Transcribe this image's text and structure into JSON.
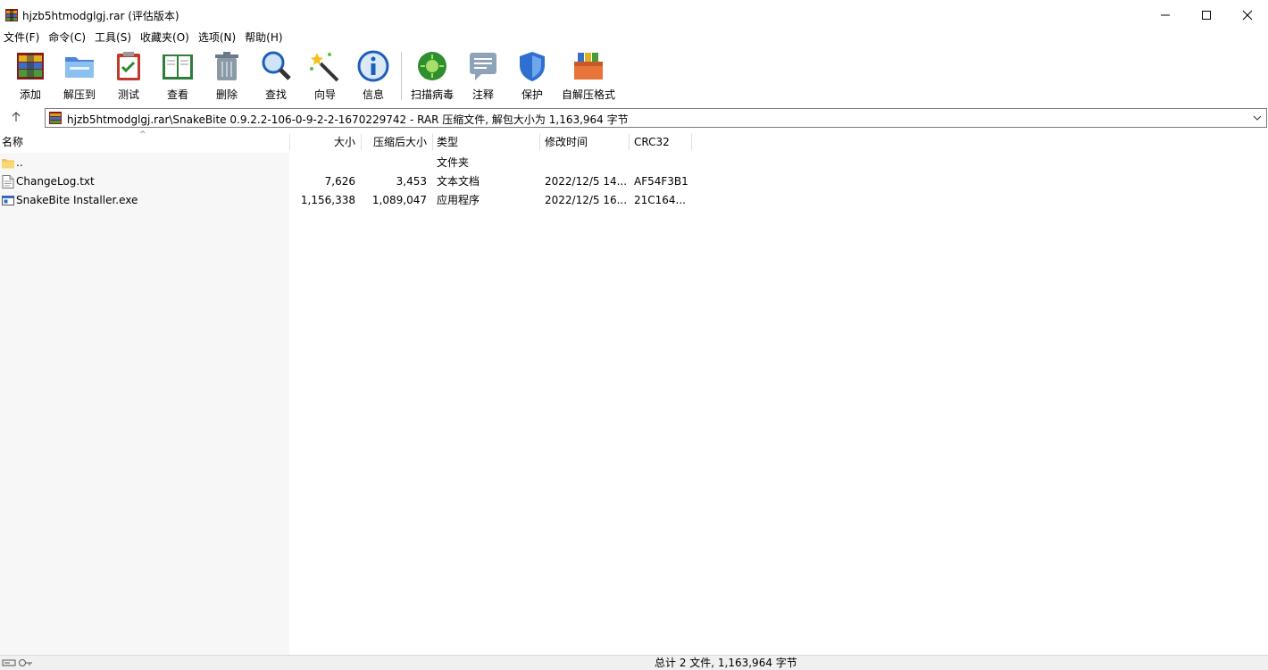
{
  "window": {
    "title": "hjzb5htmodglgj.rar (评估版本)"
  },
  "menu": [
    "文件(F)",
    "命令(C)",
    "工具(S)",
    "收藏夹(O)",
    "选项(N)",
    "帮助(H)"
  ],
  "toolbar": {
    "buttons": [
      {
        "label": "添加",
        "icon": "add-archive-icon"
      },
      {
        "label": "解压到",
        "icon": "extract-to-folder-icon"
      },
      {
        "label": "测试",
        "icon": "test-clipboard-icon"
      },
      {
        "label": "查看",
        "icon": "view-book-icon"
      },
      {
        "label": "删除",
        "icon": "trash-icon"
      },
      {
        "label": "查找",
        "icon": "magnifier-icon"
      },
      {
        "label": "向导",
        "icon": "wizard-wand-icon"
      },
      {
        "label": "信息",
        "icon": "info-icon"
      },
      {
        "label": "扫描病毒",
        "icon": "virus-scan-icon"
      },
      {
        "label": "注释",
        "icon": "comment-icon"
      },
      {
        "label": "保护",
        "icon": "shield-icon"
      },
      {
        "label": "自解压格式",
        "icon": "sfx-icon"
      }
    ]
  },
  "address": {
    "path": "hjzb5htmodglgj.rar\\SnakeBite 0.9.2.2-106-0-9-2-2-1670229742 - RAR 压缩文件, 解包大小为 1,163,964 字节"
  },
  "columns": {
    "name": "名称",
    "size": "大小",
    "packed": "压缩后大小",
    "type": "类型",
    "modified": "修改时间",
    "crc": "CRC32"
  },
  "files": [
    {
      "name": "..",
      "size": "",
      "packed": "",
      "type": "文件夹",
      "modified": "",
      "crc": ""
    },
    {
      "name": "ChangeLog.txt",
      "size": "7,626",
      "packed": "3,453",
      "type": "文本文档",
      "modified": "2022/12/5 14...",
      "crc": "AF54F3B1"
    },
    {
      "name": "SnakeBite Installer.exe",
      "size": "1,156,338",
      "packed": "1,089,047",
      "type": "应用程序",
      "modified": "2022/12/5 16...",
      "crc": "21C164..."
    }
  ],
  "status": {
    "summary": "总计 2 文件, 1,163,964 字节"
  }
}
